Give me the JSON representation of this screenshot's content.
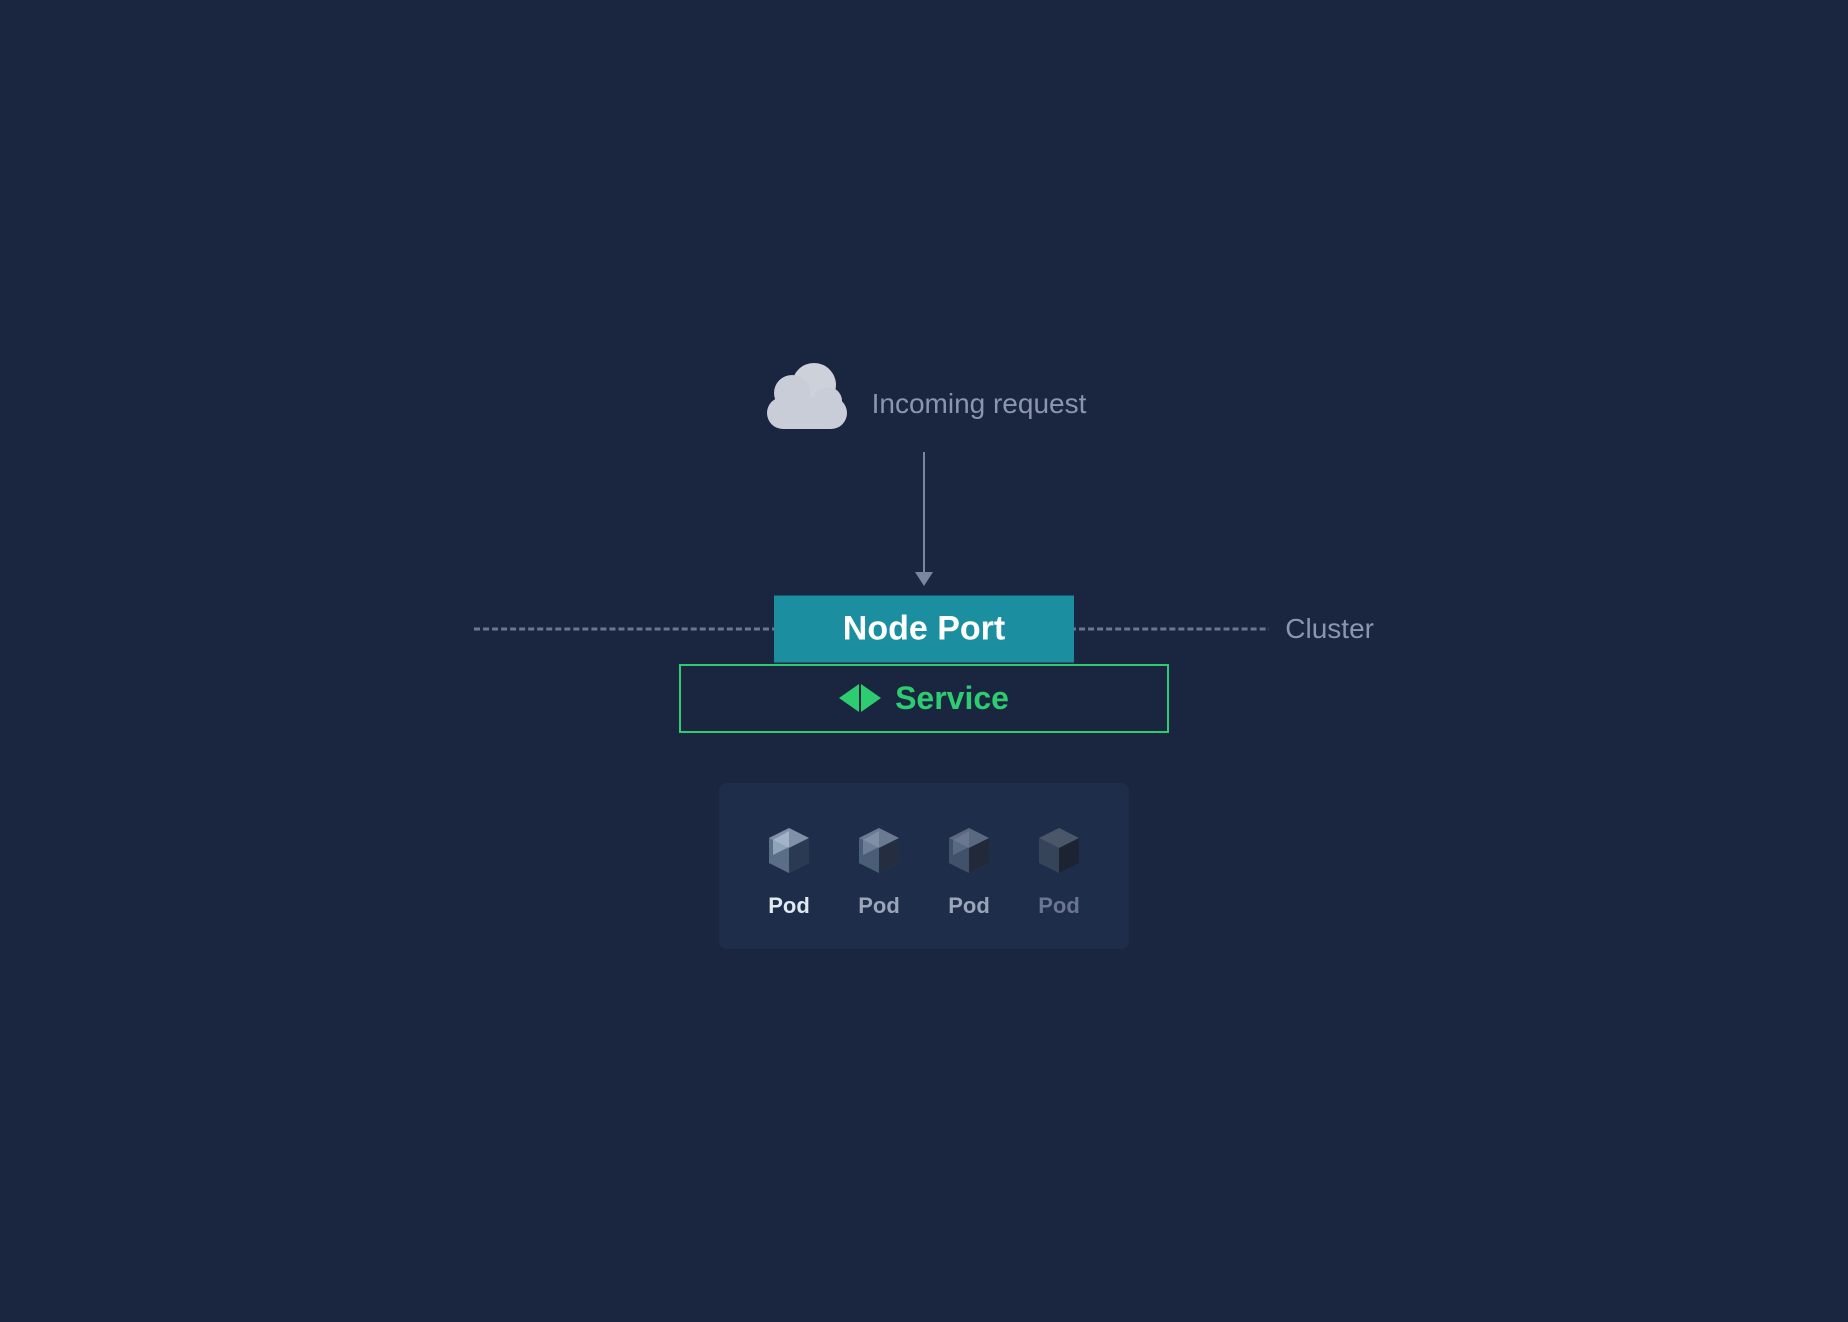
{
  "diagram": {
    "incoming_label": "Incoming request",
    "cluster_label": "Cluster",
    "node_port_label": "Node Port",
    "service_label": "Service",
    "pods": [
      {
        "label": "Pod",
        "brightness": "bright"
      },
      {
        "label": "Pod",
        "brightness": "mid"
      },
      {
        "label": "Pod",
        "brightness": "dim"
      },
      {
        "label": "Pod",
        "brightness": "darker"
      }
    ]
  },
  "colors": {
    "bg": "#1a2540",
    "node_port_bg": "#1b8fa0",
    "service_border": "#2ecc71",
    "service_text": "#2ecc71",
    "cluster_text": "#8a95b0",
    "incoming_text": "#8a95b0",
    "pod_label_bright": "#e0e8f0",
    "pod_label_mid": "#9aa5b8",
    "pod_label_dim": "#6a7590"
  }
}
